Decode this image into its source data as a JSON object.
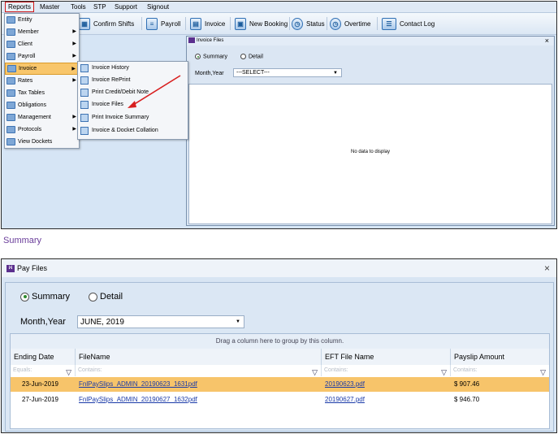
{
  "menubar": {
    "items": [
      "Reports",
      "Master",
      "Tools",
      "STP",
      "Support",
      "Signout"
    ]
  },
  "toolbar": {
    "buttons": [
      "Confirm Shifts",
      "Payroll",
      "Invoice",
      "New Booking",
      "Status",
      "Overtime",
      "Contact Log"
    ]
  },
  "reports_menu": {
    "items": [
      {
        "label": "Entity",
        "submenu": false,
        "icon": "entity-icon"
      },
      {
        "label": "Member",
        "submenu": true,
        "icon": "member-icon"
      },
      {
        "label": "Client",
        "submenu": true,
        "icon": "client-icon"
      },
      {
        "label": "Payroll",
        "submenu": true,
        "icon": "payroll-icon"
      },
      {
        "label": "Invoice",
        "submenu": true,
        "icon": "invoice-icon",
        "highlighted": true
      },
      {
        "label": "Rates",
        "submenu": true,
        "icon": "rates-icon"
      },
      {
        "label": "Tax Tables",
        "submenu": false,
        "icon": "tax-tables-icon"
      },
      {
        "label": "Obligations",
        "submenu": false,
        "icon": "obligations-icon"
      },
      {
        "label": "Management",
        "submenu": true,
        "icon": "management-icon"
      },
      {
        "label": "Protocols",
        "submenu": true,
        "icon": "protocols-icon"
      },
      {
        "label": "View Dockets",
        "submenu": false,
        "icon": "view-dockets-icon"
      }
    ]
  },
  "invoice_submenu": {
    "items": [
      "Invoice History",
      "Invoice RePrint",
      "Print Credit/Debit Note",
      "Invoice Files",
      "Print Invoice Summary",
      "Invoice & Docket Collation"
    ]
  },
  "invoice_files_window": {
    "title": "Invoice Files",
    "radio_summary": "Summary",
    "radio_detail": "Detail",
    "month_year_label": "Month,Year",
    "month_year_value": "---SELECT---",
    "empty_text": "No data to display",
    "close": "×"
  },
  "section_label": "Summary",
  "pay_files_window": {
    "title": "Pay Files",
    "close": "×",
    "radio_summary": "Summary",
    "radio_detail": "Detail",
    "month_year_label": "Month,Year",
    "month_year_value": "JUNE, 2019",
    "group_hint": "Drag a column here to group by this column.",
    "columns": [
      "Ending Date",
      "FileName",
      "EFT File Name",
      "Payslip Amount"
    ],
    "filter_placeholders": [
      "Equals:",
      "Contains:",
      "Contains:",
      "Contains:"
    ],
    "rows": [
      {
        "ending_date": "23-Jun-2019",
        "file_name": "FnlPaySlips_ADMIN_20190623_1631pdf",
        "eft_file": "20190623.pdf",
        "amount": "$ 907.46",
        "selected": true
      },
      {
        "ending_date": "27-Jun-2019",
        "file_name": "FnlPaySlips_ADMIN_20190627_1632pdf",
        "eft_file": "20190627.pdf",
        "amount": "$ 946.70",
        "selected": false
      }
    ]
  },
  "colors": {
    "selected_row": "#f7c46a",
    "highlight_border": "#d01818",
    "annotation_arrow": "#d81f1f"
  }
}
